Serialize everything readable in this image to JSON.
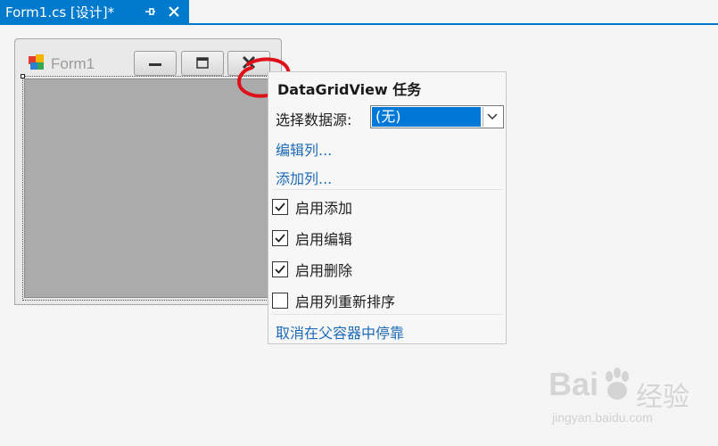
{
  "document_tab": {
    "title": "Form1.cs [设计]*",
    "pin_icon": "pin-icon",
    "close_icon": "close-icon"
  },
  "designer_form": {
    "title": "Form1",
    "icon": "form-app-icon",
    "caption_buttons": [
      "minimize-icon",
      "maximize-icon",
      "close-icon"
    ]
  },
  "tasks_panel": {
    "title": "DataGridView 任务",
    "data_source_label": "选择数据源:",
    "data_source_value": "(无)",
    "links": {
      "edit_columns": "编辑列...",
      "add_column": "添加列..."
    },
    "checkboxes": [
      {
        "label": "启用添加",
        "checked": true
      },
      {
        "label": "启用编辑",
        "checked": true
      },
      {
        "label": "启用删除",
        "checked": true
      },
      {
        "label": "启用列重新排序",
        "checked": false
      }
    ],
    "dock_link": "取消在父容器中停靠"
  },
  "watermark": {
    "brand": "Bai",
    "cn": "经验",
    "url": "jingyan.baidu.com"
  },
  "colors": {
    "accent": "#007acc",
    "link": "#1e6bb8",
    "selection": "#0078d7",
    "annotation": "#e0101a"
  }
}
